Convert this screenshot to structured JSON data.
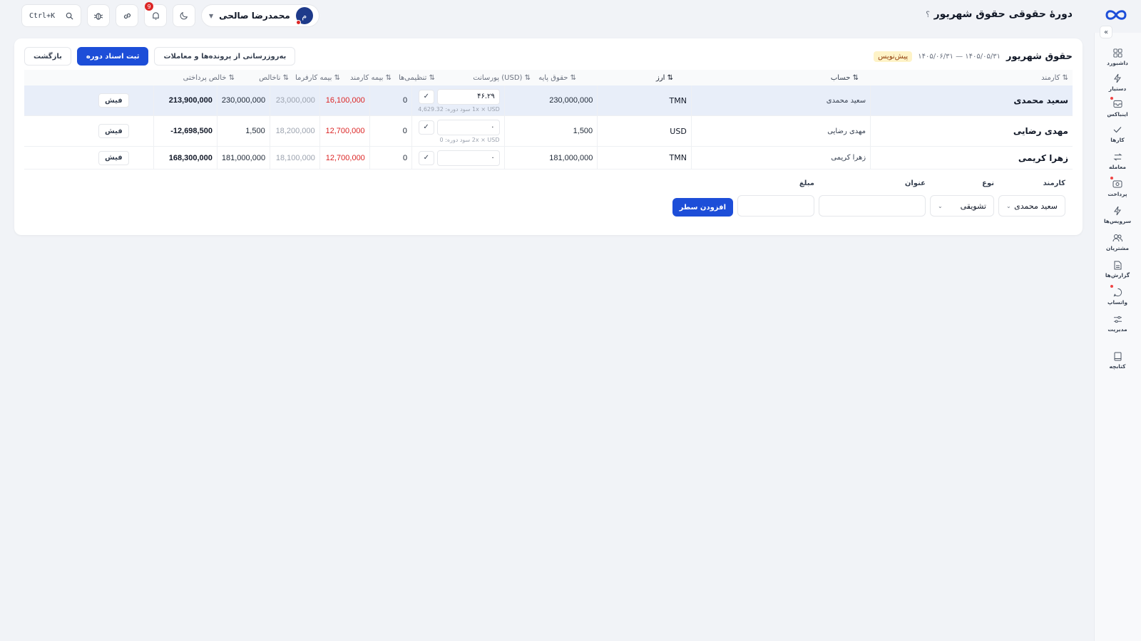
{
  "header": {
    "title": "دورهٔ حقوقی حقوق شهریور",
    "help": "؟",
    "search_shortcut": "Ctrl+K",
    "notifications_count": "9",
    "user": {
      "name": "محمدرضا صالحی",
      "initial": "م"
    }
  },
  "sidebar": {
    "items": [
      {
        "label": "داشبورد",
        "icon": "dashboard-icon"
      },
      {
        "label": "دستیار",
        "icon": "bolt-icon"
      },
      {
        "label": "اینباکس",
        "icon": "inbox-icon"
      },
      {
        "label": "کارها",
        "icon": "check-icon"
      },
      {
        "label": "معامله",
        "icon": "exchange-icon"
      },
      {
        "label": "پرداخت",
        "icon": "payment-icon"
      },
      {
        "label": "سرویس‌ها",
        "icon": "services-icon"
      },
      {
        "label": "مشتریان",
        "icon": "users-icon"
      },
      {
        "label": "گزارش‌ها",
        "icon": "report-icon"
      },
      {
        "label": "واتساپ",
        "icon": "chat-icon"
      },
      {
        "label": "مدیریت",
        "icon": "settings-sliders-icon"
      },
      {
        "label": "کتابچه",
        "icon": "book-icon"
      }
    ]
  },
  "period": {
    "title": "حقوق شهریور",
    "dates": "۱۴۰۵/۰۵/۳۱ — ۱۴۰۵/۰۶/۳۱",
    "status": "پیش‌نویس",
    "actions": {
      "refresh": "به‌روزرسانی از پرونده‌ها و معاملات",
      "post": "ثبت اسناد دوره",
      "back": "بازگشت"
    }
  },
  "table": {
    "columns": {
      "employee": "⇅ کارمند",
      "account": "⇅ حساب",
      "currency": "⇅ ارز",
      "base": "⇅ حقوق پایه",
      "commission": "⇅ (USD) پورسانت",
      "adjustments": "⇅ تنظیمی‌ها",
      "emp_insurance": "⇅ بیمه کارمند",
      "er_insurance": "⇅ بیمه کارفرما",
      "gross": "⇅ ناخالص",
      "net": "⇅ خالص پرداختی"
    },
    "rows": [
      {
        "employee": "سعید محمدی",
        "account": "سعید محمدی",
        "currency": "TMN",
        "base": "230,000,000",
        "commission_value": "۴۶.۲۹",
        "commission_note": "1x × USD سود دوره: 4,629.32",
        "adjustments": "0",
        "emp_insurance": "16,100,000",
        "er_insurance": "23,000,000",
        "gross": "230,000,000",
        "net": "213,900,000",
        "slip": "فیش"
      },
      {
        "employee": "مهدی رضایی",
        "account": "مهدی رضایی",
        "currency": "USD",
        "base": "1,500",
        "commission_value": "۰",
        "commission_note": "2x × USD سود دوره: 0",
        "adjustments": "0",
        "emp_insurance": "12,700,000",
        "er_insurance": "18,200,000",
        "gross": "1,500",
        "net": "-12,698,500",
        "slip": "فیش"
      },
      {
        "employee": "زهرا کریمی",
        "account": "زهرا کریمی",
        "currency": "TMN",
        "base": "181,000,000",
        "commission_value": "۰",
        "commission_note": "",
        "adjustments": "0",
        "emp_insurance": "12,700,000",
        "er_insurance": "18,100,000",
        "gross": "181,000,000",
        "net": "168,300,000",
        "slip": "فیش"
      }
    ]
  },
  "add_form": {
    "employee_label": "کارمند",
    "employee_value": "سعید محمدی",
    "type_label": "نوع",
    "type_value": "تشویقی",
    "title_label": "عنوان",
    "title_value": "",
    "amount_label": "مبلغ",
    "amount_value": "",
    "submit": "افزودن سطر"
  }
}
